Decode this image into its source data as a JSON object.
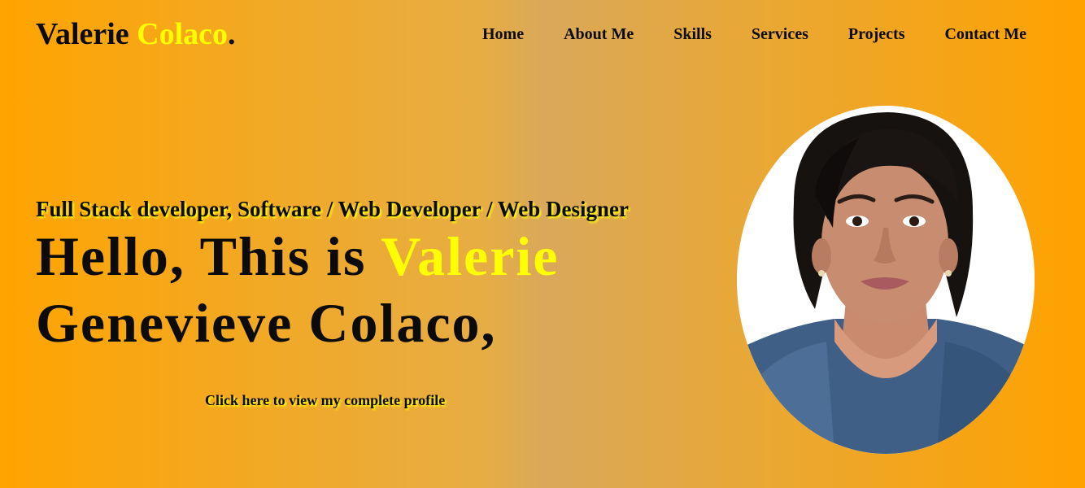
{
  "header": {
    "logo_first": "Valerie",
    "logo_accent": "Colaco",
    "logo_dot": "."
  },
  "nav": {
    "items": [
      "Home",
      "About Me",
      "Skills",
      "Services",
      "Projects",
      "Contact Me"
    ]
  },
  "hero": {
    "subtitle": "Full Stack developer, Software / Web Developer / Web Designer",
    "headline_prefix": "Hello, This is",
    "headline_accent": "Valerie",
    "headline_line2": "Genevieve Colaco,",
    "profile_link": "Click here to view my complete profile"
  },
  "colors": {
    "accent": "#ffff00",
    "background_edge": "#ffa400",
    "background_center": "#d9a85a",
    "text": "#0b0b0b"
  }
}
